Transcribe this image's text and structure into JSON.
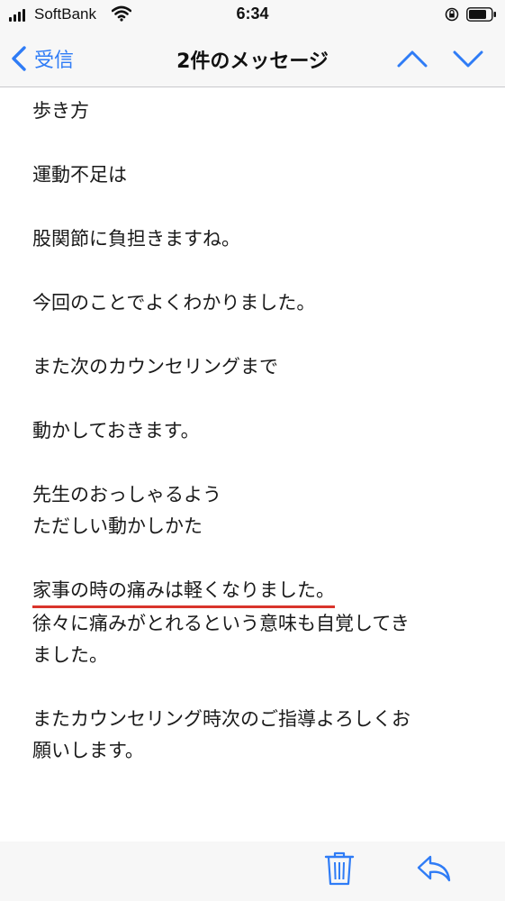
{
  "status_bar": {
    "carrier": "SoftBank",
    "time": "6:34"
  },
  "nav": {
    "back_label": "受信",
    "title": "2件のメッセージ"
  },
  "message": {
    "paragraphs": [
      [
        "歩き方"
      ],
      [
        "運動不足は"
      ],
      [
        "股関節に負担きますね。"
      ],
      [
        "今回のことでよくわかりました。"
      ],
      [
        "また次のカウンセリングまで"
      ],
      [
        "動かしておきます。"
      ],
      [
        "先生のおっしゃるよう",
        "ただしい動かしかた"
      ],
      [
        "家事の時の痛みは軽くなりました。",
        "徐々に痛みがとれるという意味も自覚してき",
        "ました。"
      ],
      [
        "またカウンセリング時次のご指導よろしくお",
        "願いします。"
      ]
    ]
  },
  "colors": {
    "accent": "#2f7cf6",
    "underline": "#d9342b",
    "bar_background": "#f7f7f7"
  },
  "icons": {
    "signal": "signal-icon",
    "wifi": "wifi-icon",
    "rotation_lock": "rotation-lock-icon",
    "battery": "battery-icon",
    "back": "chevron-left-icon",
    "up": "chevron-up-icon",
    "down": "chevron-down-icon",
    "trash": "trash-icon",
    "reply": "reply-icon"
  }
}
